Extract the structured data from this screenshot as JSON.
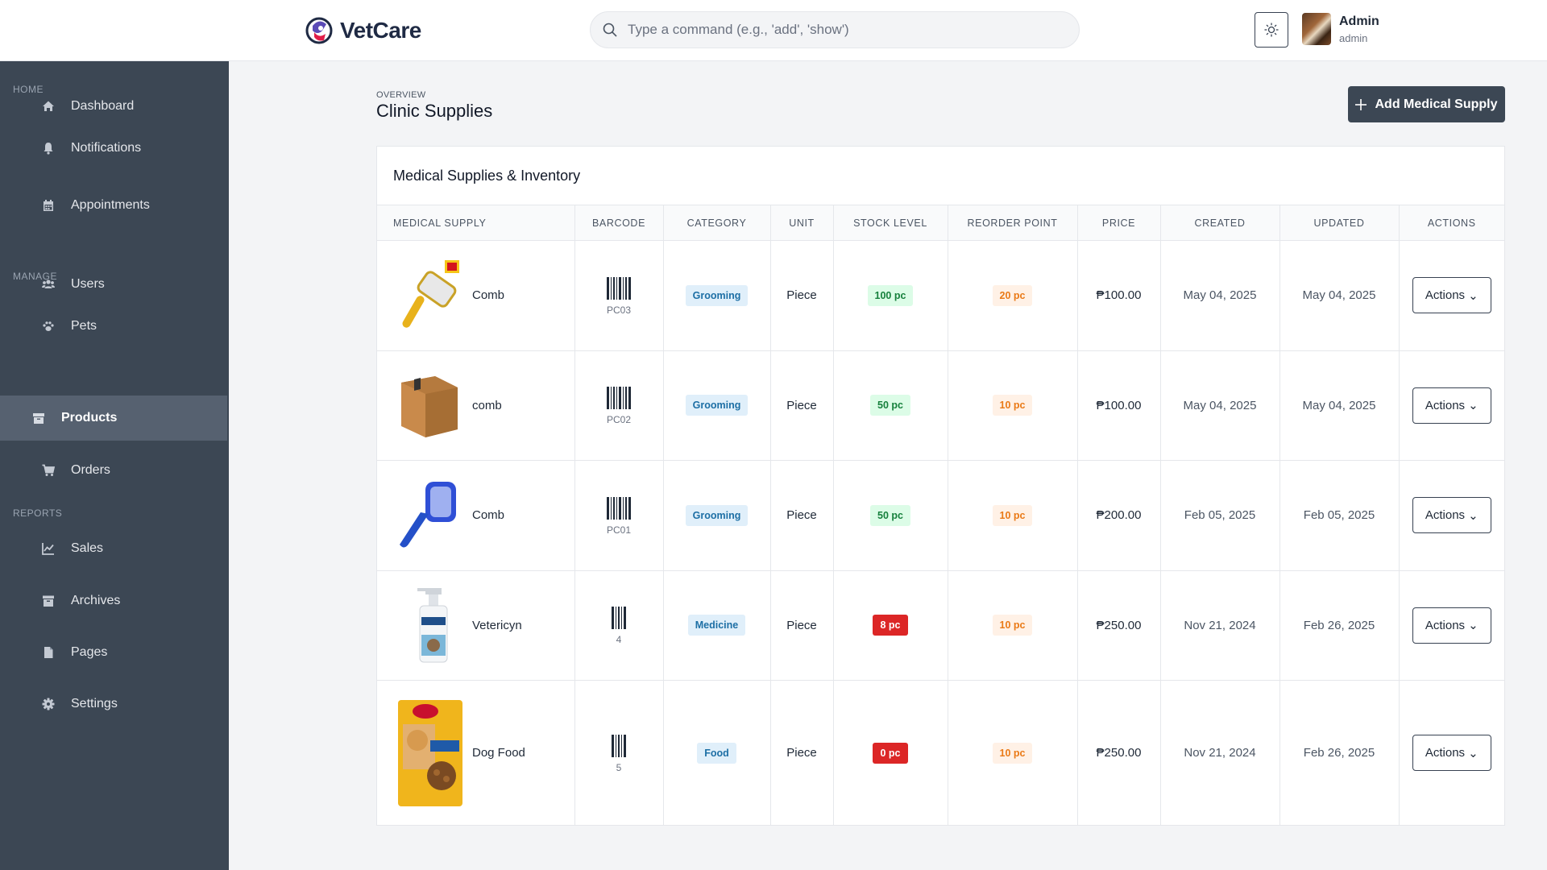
{
  "app": {
    "name": "VetCare"
  },
  "search": {
    "placeholder": "Type a command (e.g., 'add', 'show')"
  },
  "user": {
    "name": "Admin",
    "role": "admin"
  },
  "sidebar": {
    "sections": {
      "home": "HOME",
      "manage": "MANAGE",
      "reports": "REPORTS"
    },
    "items": [
      {
        "label": "Dashboard",
        "icon": "home-icon"
      },
      {
        "label": "Notifications",
        "icon": "bell-icon"
      },
      {
        "label": "Appointments",
        "icon": "calendar-icon"
      },
      {
        "label": "Users",
        "icon": "users-icon"
      },
      {
        "label": "Pets",
        "icon": "paw-icon"
      },
      {
        "label": "Products",
        "icon": "box-icon",
        "active": true
      },
      {
        "label": "Orders",
        "icon": "cart-icon"
      },
      {
        "label": "Sales",
        "icon": "chart-line-icon"
      },
      {
        "label": "Archives",
        "icon": "archive-icon"
      },
      {
        "label": "Pages",
        "icon": "file-icon"
      },
      {
        "label": "Settings",
        "icon": "gear-icon"
      }
    ]
  },
  "page": {
    "eyebrow": "OVERVIEW",
    "title": "Clinic Supplies",
    "add_button": "Add Medical Supply"
  },
  "card": {
    "title": "Medical Supplies & Inventory"
  },
  "table": {
    "columns": [
      "MEDICAL SUPPLY",
      "BARCODE",
      "CATEGORY",
      "UNIT",
      "STOCK LEVEL",
      "REORDER POINT",
      "PRICE",
      "CREATED",
      "UPDATED",
      "ACTIONS"
    ],
    "rows": [
      {
        "name": "Comb",
        "image": "slicker-brush-yellow",
        "barcode": "PC03",
        "category": "Grooming",
        "unit": "Piece",
        "stock": "100 pc",
        "stock_status": "ok",
        "reorder": "20 pc",
        "price": "₱100.00",
        "created": "May 04, 2025",
        "updated": "May 04, 2025",
        "action": "Actions"
      },
      {
        "name": "comb",
        "image": "cardboard-box",
        "barcode": "PC02",
        "category": "Grooming",
        "unit": "Piece",
        "stock": "50 pc",
        "stock_status": "ok",
        "reorder": "10 pc",
        "price": "₱100.00",
        "created": "May 04, 2025",
        "updated": "May 04, 2025",
        "action": "Actions"
      },
      {
        "name": "Comb",
        "image": "slicker-brush-blue",
        "barcode": "PC01",
        "category": "Grooming",
        "unit": "Piece",
        "stock": "50 pc",
        "stock_status": "ok",
        "reorder": "10 pc",
        "price": "₱200.00",
        "created": "Feb 05, 2025",
        "updated": "Feb 05, 2025",
        "action": "Actions"
      },
      {
        "name": "Vetericyn",
        "image": "spray-bottle",
        "barcode": "4",
        "category": "Medicine",
        "unit": "Piece",
        "stock": "8 pc",
        "stock_status": "low",
        "reorder": "10 pc",
        "price": "₱250.00",
        "created": "Nov 21, 2024",
        "updated": "Feb 26, 2025",
        "action": "Actions"
      },
      {
        "name": "Dog Food",
        "image": "dog-food-bag",
        "barcode": "5",
        "category": "Food",
        "unit": "Piece",
        "stock": "0 pc",
        "stock_status": "low",
        "reorder": "10 pc",
        "price": "₱250.00",
        "created": "Nov 21, 2024",
        "updated": "Feb 26, 2025",
        "action": "Actions"
      }
    ]
  },
  "colors": {
    "sidebar_bg": "#3c4754",
    "sidebar_active": "#566170",
    "primary_button": "#3c4754",
    "stock_ok": "#16803c",
    "stock_low": "#dc2626",
    "reorder": "#ea7a17",
    "category": "#1d6fa5"
  }
}
